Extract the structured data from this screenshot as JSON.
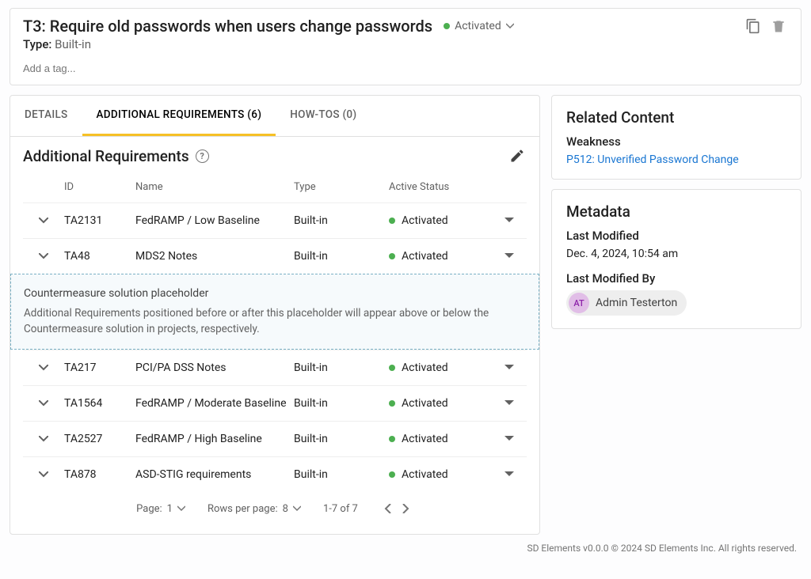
{
  "header": {
    "title": "T3: Require old passwords when users change passwords",
    "status_label": "Activated",
    "type_label": "Type:",
    "type_value": "Built-in",
    "tag_placeholder": "Add a tag..."
  },
  "tabs": {
    "details": "Details",
    "additional": "Additional Requirements (6)",
    "howtos": "How-Tos (0)"
  },
  "section": {
    "heading": "Additional Requirements"
  },
  "columns": {
    "id": "ID",
    "name": "Name",
    "type": "Type",
    "active": "Active Status"
  },
  "rows": [
    {
      "id": "TA2131",
      "name": "FedRAMP / Low Baseline",
      "type": "Built-in",
      "status": "Activated"
    },
    {
      "id": "TA48",
      "name": "MDS2 Notes",
      "type": "Built-in",
      "status": "Activated"
    },
    {
      "id": "TA217",
      "name": "PCI/PA DSS Notes",
      "type": "Built-in",
      "status": "Activated"
    },
    {
      "id": "TA1564",
      "name": "FedRAMP / Moderate Baseline",
      "type": "Built-in",
      "status": "Activated"
    },
    {
      "id": "TA2527",
      "name": "FedRAMP / High Baseline",
      "type": "Built-in",
      "status": "Activated"
    },
    {
      "id": "TA878",
      "name": "ASD-STIG requirements",
      "type": "Built-in",
      "status": "Activated"
    }
  ],
  "placeholder": {
    "title": "Countermeasure solution placeholder",
    "desc": "Additional Requirements positioned before or after this placeholder will appear above or below the Countermeasure solution in projects, respectively."
  },
  "pager": {
    "page_label": "Page:",
    "page_value": "1",
    "rpp_label": "Rows per page:",
    "rpp_value": "8",
    "range": "1-7 of 7"
  },
  "related": {
    "heading": "Related Content",
    "weakness_label": "Weakness",
    "weakness_link": "P512: Unverified Password Change"
  },
  "metadata": {
    "heading": "Metadata",
    "modified_label": "Last Modified",
    "modified_value": "Dec. 4, 2024, 10:54 am",
    "modified_by_label": "Last Modified By",
    "avatar_initials": "AT",
    "modified_by_name": "Admin Testerton"
  },
  "footer": "SD Elements v0.0.0 © 2024 SD Elements Inc. All rights reserved."
}
